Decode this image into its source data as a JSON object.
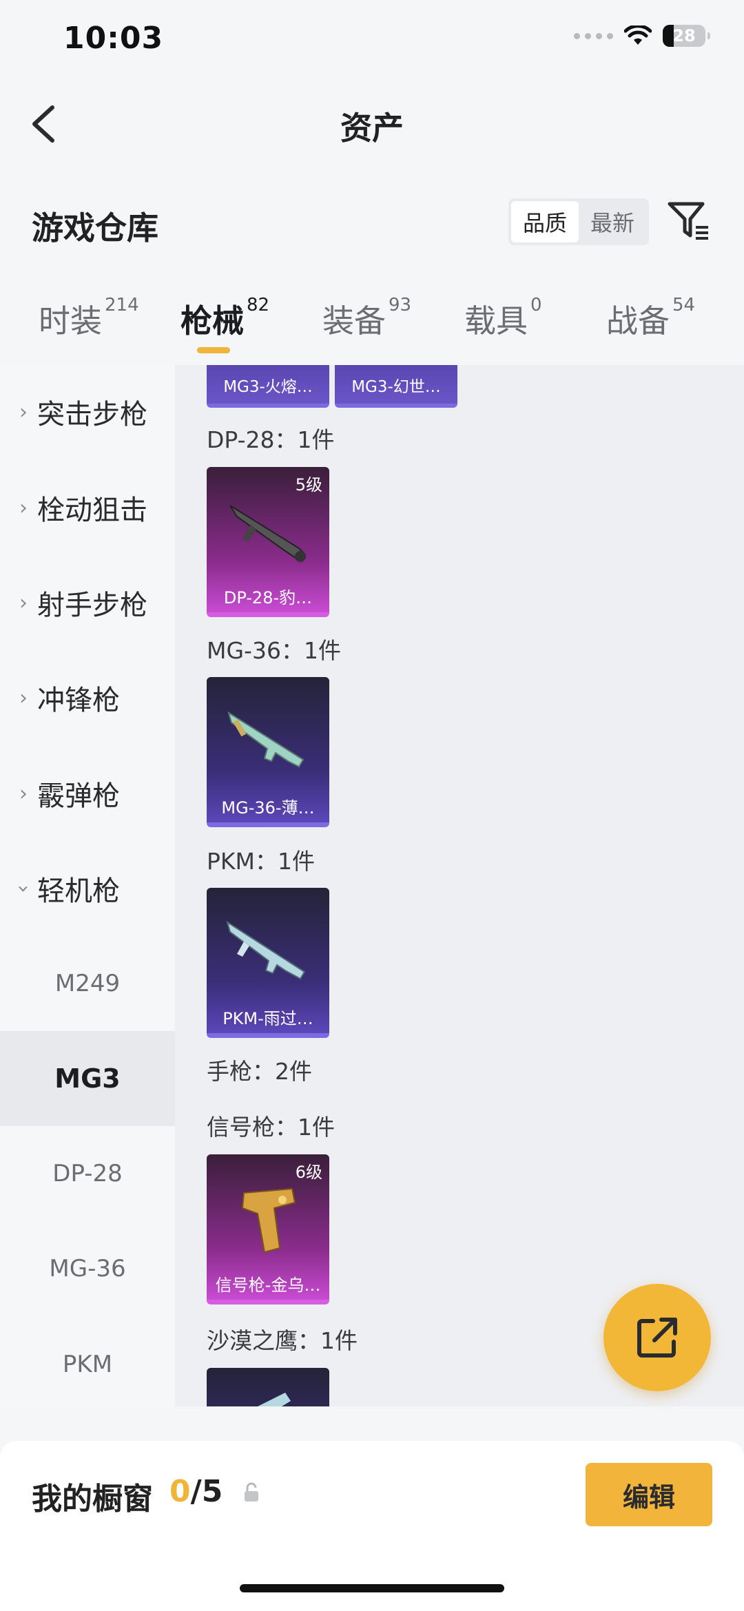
{
  "status": {
    "time": "10:03",
    "battery": "28"
  },
  "header": {
    "title": "资产"
  },
  "warehouse": {
    "title": "游戏仓库",
    "sort_options": [
      "品质",
      "最新"
    ]
  },
  "tabs": [
    {
      "label": "时装",
      "count": "214"
    },
    {
      "label": "枪械",
      "count": "82"
    },
    {
      "label": "装备",
      "count": "93"
    },
    {
      "label": "载具",
      "count": "0"
    },
    {
      "label": "战备",
      "count": "54"
    }
  ],
  "sidebar": {
    "categories": [
      "突击步枪",
      "栓动狙击",
      "射手步枪",
      "冲锋枪",
      "霰弹枪",
      "轻机枪"
    ],
    "subcategories": [
      "M249",
      "MG3",
      "DP-28",
      "MG-36",
      "PKM"
    ]
  },
  "content": {
    "top_cards": [
      "MG3-火熔…",
      "MG3-幻世…"
    ],
    "groups": [
      {
        "title": "DP-28：1件",
        "card": {
          "name": "DP-28-豹…",
          "level": "5级"
        }
      },
      {
        "title": "MG-36：1件",
        "card": {
          "name": "MG-36-薄…",
          "level": ""
        }
      },
      {
        "title": "PKM：1件",
        "card": {
          "name": "PKM-雨过…",
          "level": ""
        }
      },
      {
        "title": "手枪：2件"
      },
      {
        "title": "信号枪：1件",
        "card": {
          "name": "信号枪-金乌…",
          "level": "6级"
        }
      },
      {
        "title": "沙漠之鹰：1件"
      }
    ]
  },
  "showcase": {
    "title": "我的橱窗",
    "used": "0",
    "total": "/5",
    "edit_label": "编辑"
  },
  "colors": {
    "accent": "#f0b43a",
    "pink_card": "#c84bd2",
    "purple_card": "#5b47b8"
  }
}
